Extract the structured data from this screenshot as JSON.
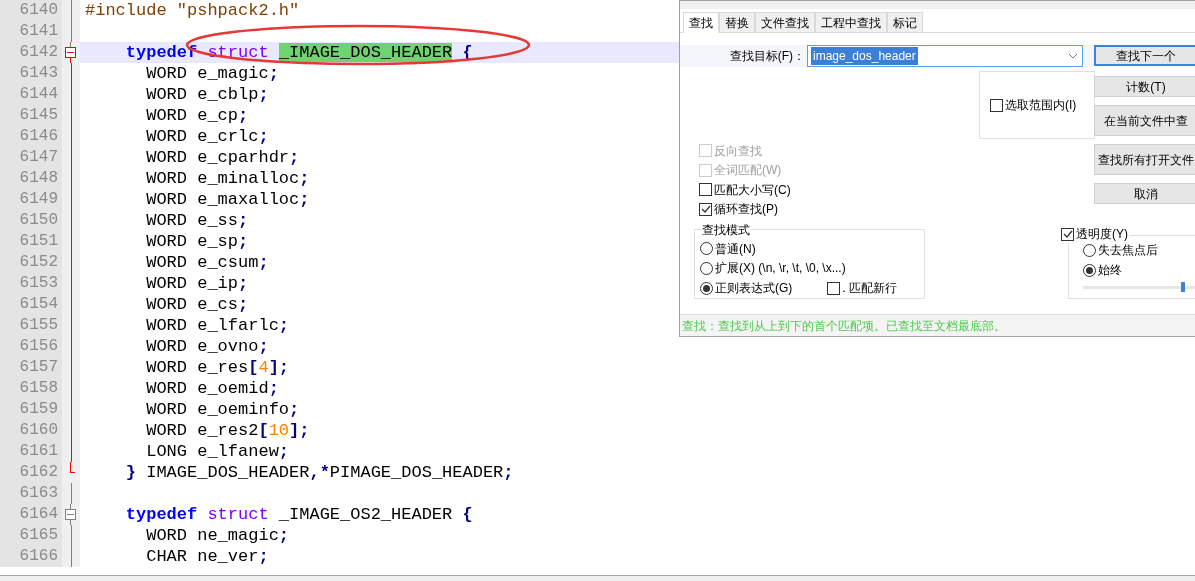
{
  "editor": {
    "lines": [
      {
        "number": "6140",
        "kind": "body",
        "active": false,
        "current": false,
        "tokens": [
          {
            "kind": "pre",
            "text": "#include \"pshpack2.h\""
          }
        ]
      },
      {
        "number": "6141",
        "kind": "body",
        "active": false,
        "current": false
      },
      {
        "number": "6142",
        "kind": "start",
        "active": true,
        "current": true,
        "tokens": [
          {
            "kind": "kw",
            "text": "    typedef"
          },
          {
            "kind": "type",
            "text": " struct "
          },
          {
            "kind": "match",
            "text": "_IMAGE_DOS_HEADER"
          },
          {
            "kind": "op",
            "text": " {"
          }
        ]
      },
      {
        "number": "6143",
        "kind": "body",
        "active": true,
        "current": false,
        "tokens": [
          {
            "kind": "text",
            "text": "      WORD e_magic"
          },
          {
            "kind": "op",
            "text": ";"
          }
        ]
      },
      {
        "number": "6144",
        "kind": "body",
        "active": true,
        "current": false,
        "tokens": [
          {
            "kind": "text",
            "text": "      WORD e_cblp"
          },
          {
            "kind": "op",
            "text": ";"
          }
        ]
      },
      {
        "number": "6145",
        "kind": "body",
        "active": true,
        "current": false,
        "tokens": [
          {
            "kind": "text",
            "text": "      WORD e_cp"
          },
          {
            "kind": "op",
            "text": ";"
          }
        ]
      },
      {
        "number": "6146",
        "kind": "body",
        "active": true,
        "current": false,
        "tokens": [
          {
            "kind": "text",
            "text": "      WORD e_crlc"
          },
          {
            "kind": "op",
            "text": ";"
          }
        ]
      },
      {
        "number": "6147",
        "kind": "body",
        "active": true,
        "current": false,
        "tokens": [
          {
            "kind": "text",
            "text": "      WORD e_cparhdr"
          },
          {
            "kind": "op",
            "text": ";"
          }
        ]
      },
      {
        "number": "6148",
        "kind": "body",
        "active": true,
        "current": false,
        "tokens": [
          {
            "kind": "text",
            "text": "      WORD e_minalloc"
          },
          {
            "kind": "op",
            "text": ";"
          }
        ]
      },
      {
        "number": "6149",
        "kind": "body",
        "active": true,
        "current": false,
        "tokens": [
          {
            "kind": "text",
            "text": "      WORD e_maxalloc"
          },
          {
            "kind": "op",
            "text": ";"
          }
        ]
      },
      {
        "number": "6150",
        "kind": "body",
        "active": true,
        "current": false,
        "tokens": [
          {
            "kind": "text",
            "text": "      WORD e_ss"
          },
          {
            "kind": "op",
            "text": ";"
          }
        ]
      },
      {
        "number": "6151",
        "kind": "body",
        "active": true,
        "current": false,
        "tokens": [
          {
            "kind": "text",
            "text": "      WORD e_sp"
          },
          {
            "kind": "op",
            "text": ";"
          }
        ]
      },
      {
        "number": "6152",
        "kind": "body",
        "active": true,
        "current": false,
        "tokens": [
          {
            "kind": "text",
            "text": "      WORD e_csum"
          },
          {
            "kind": "op",
            "text": ";"
          }
        ]
      },
      {
        "number": "6153",
        "kind": "body",
        "active": true,
        "current": false,
        "tokens": [
          {
            "kind": "text",
            "text": "      WORD e_ip"
          },
          {
            "kind": "op",
            "text": ";"
          }
        ]
      },
      {
        "number": "6154",
        "kind": "body",
        "active": true,
        "current": false,
        "tokens": [
          {
            "kind": "text",
            "text": "      WORD e_cs"
          },
          {
            "kind": "op",
            "text": ";"
          }
        ]
      },
      {
        "number": "6155",
        "kind": "body",
        "active": true,
        "current": false,
        "tokens": [
          {
            "kind": "text",
            "text": "      WORD e_lfarlc"
          },
          {
            "kind": "op",
            "text": ";"
          }
        ]
      },
      {
        "number": "6156",
        "kind": "body",
        "active": true,
        "current": false,
        "tokens": [
          {
            "kind": "text",
            "text": "      WORD e_ovno"
          },
          {
            "kind": "op",
            "text": ";"
          }
        ]
      },
      {
        "number": "6157",
        "kind": "body",
        "active": true,
        "current": false,
        "tokens": [
          {
            "kind": "text",
            "text": "      WORD e_res"
          },
          {
            "kind": "op",
            "text": "["
          },
          {
            "kind": "num",
            "text": "4"
          },
          {
            "kind": "op",
            "text": "];"
          }
        ]
      },
      {
        "number": "6158",
        "kind": "body",
        "active": true,
        "current": false,
        "tokens": [
          {
            "kind": "text",
            "text": "      WORD e_oemid"
          },
          {
            "kind": "op",
            "text": ";"
          }
        ]
      },
      {
        "number": "6159",
        "kind": "body",
        "active": true,
        "current": false,
        "tokens": [
          {
            "kind": "text",
            "text": "      WORD e_oeminfo"
          },
          {
            "kind": "op",
            "text": ";"
          }
        ]
      },
      {
        "number": "6160",
        "kind": "body",
        "active": true,
        "current": false,
        "tokens": [
          {
            "kind": "text",
            "text": "      WORD e_res2"
          },
          {
            "kind": "op",
            "text": "["
          },
          {
            "kind": "num",
            "text": "10"
          },
          {
            "kind": "op",
            "text": "];"
          }
        ]
      },
      {
        "number": "6161",
        "kind": "body",
        "active": true,
        "current": false,
        "tokens": [
          {
            "kind": "text",
            "text": "      LONG e_lfanew"
          },
          {
            "kind": "op",
            "text": ";"
          }
        ]
      },
      {
        "number": "6162",
        "kind": "end",
        "active": true,
        "current": false,
        "tokens": [
          {
            "kind": "op",
            "text": "    }"
          },
          {
            "kind": "text",
            "text": " IMAGE_DOS_HEADER"
          },
          {
            "kind": "op",
            "text": ",*"
          },
          {
            "kind": "text",
            "text": "PIMAGE_DOS_HEADER"
          },
          {
            "kind": "op",
            "text": ";"
          }
        ]
      },
      {
        "number": "6163",
        "kind": "body",
        "active": false,
        "current": false
      },
      {
        "number": "6164",
        "kind": "start",
        "active": false,
        "current": false,
        "tokens": [
          {
            "kind": "kw",
            "text": "    typedef"
          },
          {
            "kind": "type",
            "text": " struct"
          },
          {
            "kind": "text",
            "text": " _IMAGE_OS2_HEADER"
          },
          {
            "kind": "op",
            "text": " {"
          }
        ]
      },
      {
        "number": "6165",
        "kind": "body",
        "active": false,
        "current": false,
        "tokens": [
          {
            "kind": "text",
            "text": "      WORD ne_magic"
          },
          {
            "kind": "op",
            "text": ";"
          }
        ]
      },
      {
        "number": "6166",
        "kind": "body",
        "active": false,
        "current": false,
        "tokens": [
          {
            "kind": "text",
            "text": "      CHAR ne_ver"
          },
          {
            "kind": "op",
            "text": ";"
          }
        ]
      }
    ]
  },
  "find_dialog": {
    "tabs": [
      {
        "label": "查找",
        "selected": true
      },
      {
        "label": "替换",
        "selected": false
      },
      {
        "label": "文件查找",
        "selected": false
      },
      {
        "label": "工程中查找",
        "selected": false
      },
      {
        "label": "标记",
        "selected": false
      }
    ],
    "search_field": {
      "label": "查找目标(F)：",
      "value": "image_dos_header"
    },
    "in_selection": {
      "label": "选取范围内(I)",
      "checked": false
    },
    "options": [
      {
        "label": "反向查找",
        "checked": false,
        "disabled": true
      },
      {
        "label": "全词匹配(W)",
        "checked": false,
        "disabled": true
      },
      {
        "label": "匹配大小写(C)",
        "checked": false,
        "disabled": false
      },
      {
        "label": "循环查找(P)",
        "checked": true,
        "disabled": false
      }
    ],
    "search_mode": {
      "title": "查找模式",
      "modes": [
        {
          "label": "普通(N)",
          "selected": false
        },
        {
          "label": "扩展(X) (\\n, \\r, \\t, \\0, \\x...)",
          "selected": false
        },
        {
          "label": "正则表达式(G)",
          "selected": true
        }
      ],
      "dot_newline": {
        "label": ". 匹配新行",
        "checked": false
      }
    },
    "buttons": [
      {
        "label": "查找下一个",
        "default": true
      },
      {
        "label": "计数(T)",
        "default": false
      },
      {
        "label": "在当前文件中查",
        "default": false
      },
      {
        "label": "查找所有打开文件",
        "default": false
      },
      {
        "label": "取消",
        "default": false
      }
    ],
    "transparency": {
      "label": "透明度(Y)",
      "checked": true,
      "modes": [
        {
          "label": "失去焦点后",
          "selected": false
        },
        {
          "label": "始终",
          "selected": true
        }
      ],
      "level": 0.82
    },
    "status": "查找：查找到从上到下的首个匹配项。已查找至文档最底部。"
  }
}
